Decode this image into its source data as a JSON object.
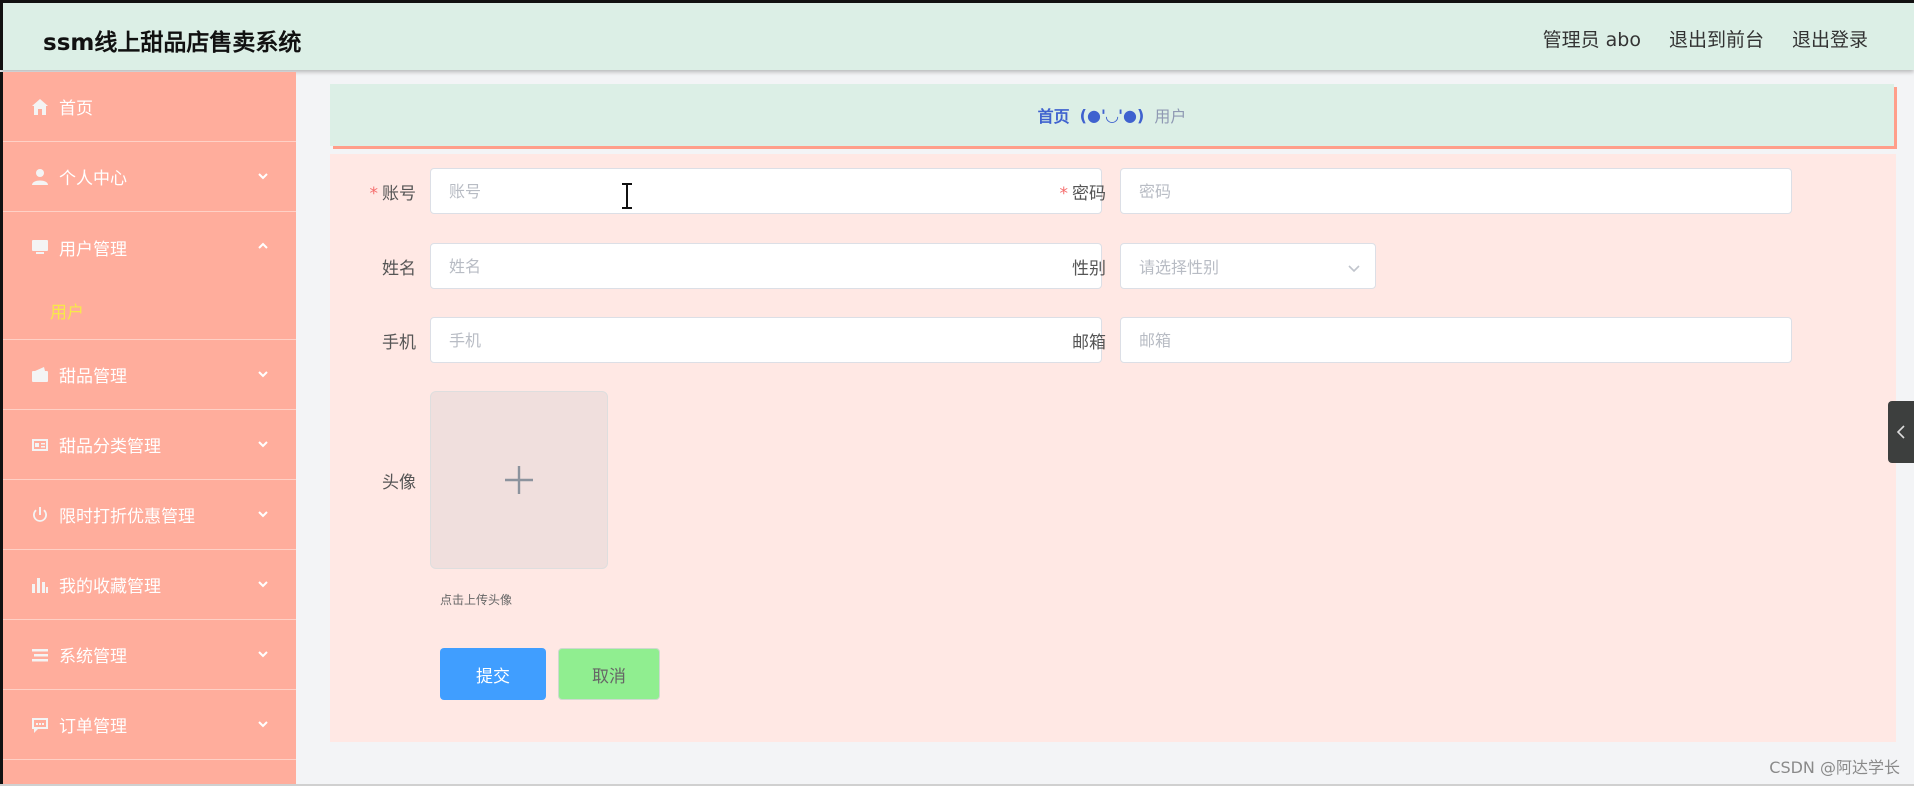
{
  "header": {
    "brand": "ssm线上甜品店售卖系统",
    "nav": [
      "管理员 abo",
      "退出到前台",
      "退出登录"
    ]
  },
  "sidebar": {
    "items": [
      {
        "label": "首页",
        "icon": "home-icon",
        "expanded": false,
        "has_children": false
      },
      {
        "label": "个人中心",
        "icon": "user-icon",
        "expanded": false,
        "has_children": true
      },
      {
        "label": "用户管理",
        "icon": "monitor-icon",
        "expanded": true,
        "has_children": true,
        "children": [
          "用户"
        ]
      },
      {
        "label": "甜品管理",
        "icon": "wallet-icon",
        "expanded": false,
        "has_children": true
      },
      {
        "label": "甜品分类管理",
        "icon": "id-card-icon",
        "expanded": false,
        "has_children": true
      },
      {
        "label": "限时打折优惠管理",
        "icon": "power-icon",
        "expanded": false,
        "has_children": true
      },
      {
        "label": "我的收藏管理",
        "icon": "bar-chart-icon",
        "expanded": false,
        "has_children": true
      },
      {
        "label": "系统管理",
        "icon": "list-icon",
        "expanded": false,
        "has_children": true
      },
      {
        "label": "订单管理",
        "icon": "chat-icon",
        "expanded": false,
        "has_children": true
      }
    ]
  },
  "breadcrumb": {
    "home": "首页",
    "separator": "(●'◡'●)",
    "current": "用户"
  },
  "form": {
    "account": {
      "label": "账号",
      "placeholder": "账号",
      "value": "",
      "required": true
    },
    "password": {
      "label": "密码",
      "placeholder": "密码",
      "value": "",
      "required": true
    },
    "name": {
      "label": "姓名",
      "placeholder": "姓名",
      "value": ""
    },
    "gender": {
      "label": "性别",
      "placeholder": "请选择性别"
    },
    "phone": {
      "label": "手机",
      "placeholder": "手机",
      "value": ""
    },
    "email": {
      "label": "邮箱",
      "placeholder": "邮箱",
      "value": ""
    },
    "avatar": {
      "label": "头像",
      "tip": "点击上传头像"
    },
    "required_mark": "*",
    "submit_label": "提交",
    "cancel_label": "取消"
  },
  "watermark": "CSDN @阿达学长",
  "colors": {
    "topbar": "#dcefe6",
    "sidebar": "#ffad9c",
    "form_bg": "#ffe8e4",
    "submit": "#409eff",
    "cancel": "#90ee90",
    "active_sub": "#f7e84a"
  }
}
